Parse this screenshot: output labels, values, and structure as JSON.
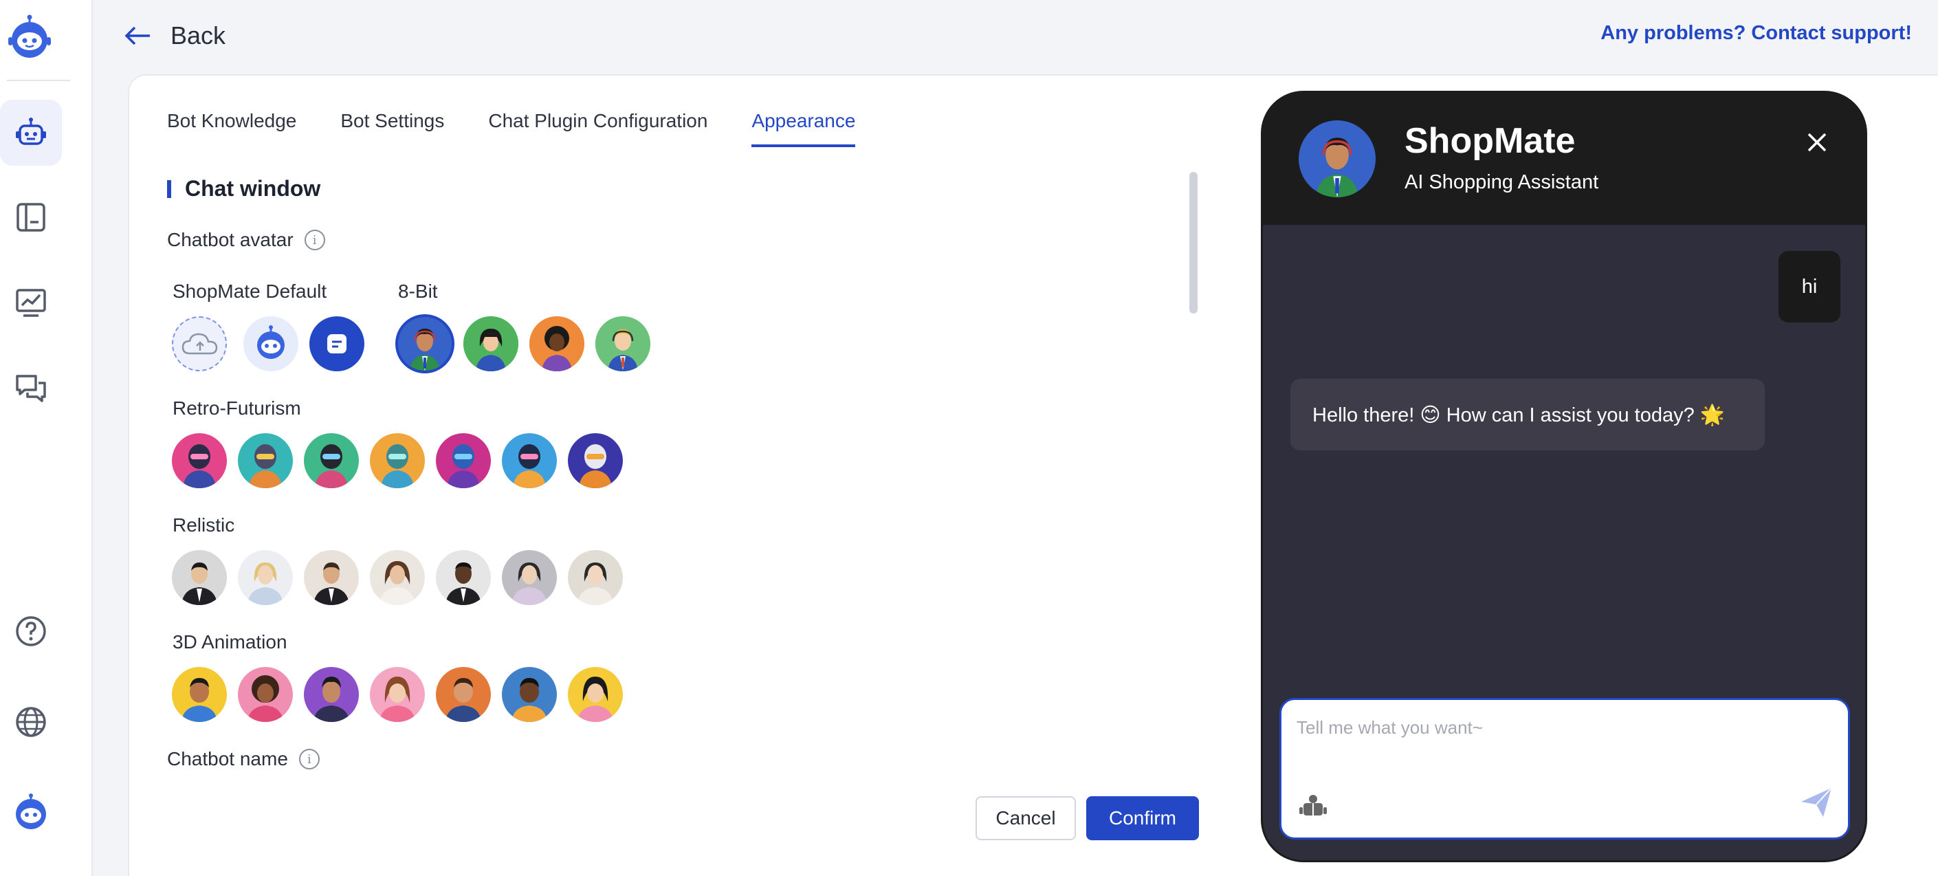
{
  "header": {
    "back_label": "Back",
    "support_link": "Any problems? Contact support!"
  },
  "sidebar": {
    "items": [
      {
        "name": "bot-icon",
        "active": true
      },
      {
        "name": "book-icon",
        "active": false
      },
      {
        "name": "analytics-icon",
        "active": false
      },
      {
        "name": "chat-bubbles-icon",
        "active": false
      },
      {
        "name": "help-icon",
        "active": false
      },
      {
        "name": "globe-icon",
        "active": false
      },
      {
        "name": "bot-profile-icon",
        "active": false
      }
    ]
  },
  "tabs": [
    {
      "label": "Bot Knowledge",
      "active": false
    },
    {
      "label": "Bot Settings",
      "active": false
    },
    {
      "label": "Chat Plugin Configuration",
      "active": false
    },
    {
      "label": "Appearance",
      "active": true
    }
  ],
  "section": {
    "title": "Chat window",
    "avatar_label": "Chatbot avatar",
    "name_label": "Chatbot name",
    "groups": {
      "default": "ShopMate Default",
      "eightbit": "8-Bit",
      "retro": "Retro-Futurism",
      "realistic": "Relistic",
      "anim3d": "3D Animation"
    }
  },
  "actions": {
    "cancel": "Cancel",
    "confirm": "Confirm"
  },
  "chat": {
    "bot_name": "ShopMate",
    "bot_subtitle": "AI Shopping Assistant",
    "user_message": "hi",
    "bot_message": "Hello there! 😊 How can I assist you today? 🌟",
    "input_placeholder": "Tell me what you want~"
  },
  "colors": {
    "accent": "#2447c6",
    "chat_bg": "#2f2e3c",
    "chat_header": "#1c1c1c"
  }
}
